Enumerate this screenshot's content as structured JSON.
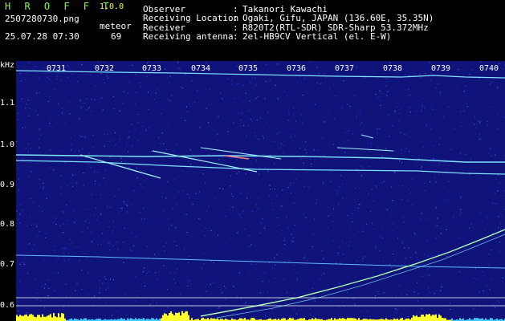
{
  "header": {
    "title": "H R O F F T",
    "version": "1.0.0",
    "filename": "2507280730.png",
    "file_type": "meteor",
    "datetime": "25.07.28 07:30",
    "count": "69"
  },
  "station": [
    {
      "label": "Observer",
      "sep": ":",
      "value": "Takanori Kawachi"
    },
    {
      "label": "Receiving Location",
      "sep": ":",
      "value": "Ogaki, Gifu, JAPAN (136.60E, 35.35N)"
    },
    {
      "label": "Receiver",
      "sep": ":",
      "value": "R820T2(RTL-SDR) SDR-Sharp 53.372MHz"
    },
    {
      "label": "Receiving antenna",
      "sep": ":",
      "value": "2el-HB9CV Vertical (el. E-W)"
    }
  ],
  "axis": {
    "unit": "kHz",
    "y_ticks": [
      "1.1",
      "1.0",
      "0.9",
      "0.8",
      "0.7",
      "0.6"
    ],
    "x_ticks": [
      "0731",
      "0732",
      "0733",
      "0734",
      "0735",
      "0736",
      "0737",
      "0738",
      "0739",
      "0740"
    ]
  },
  "colors": {
    "background": "#10147a",
    "trace": "#7fe3ff",
    "text_green": "#7cff4d",
    "text_yellow": "#ffff40"
  }
}
